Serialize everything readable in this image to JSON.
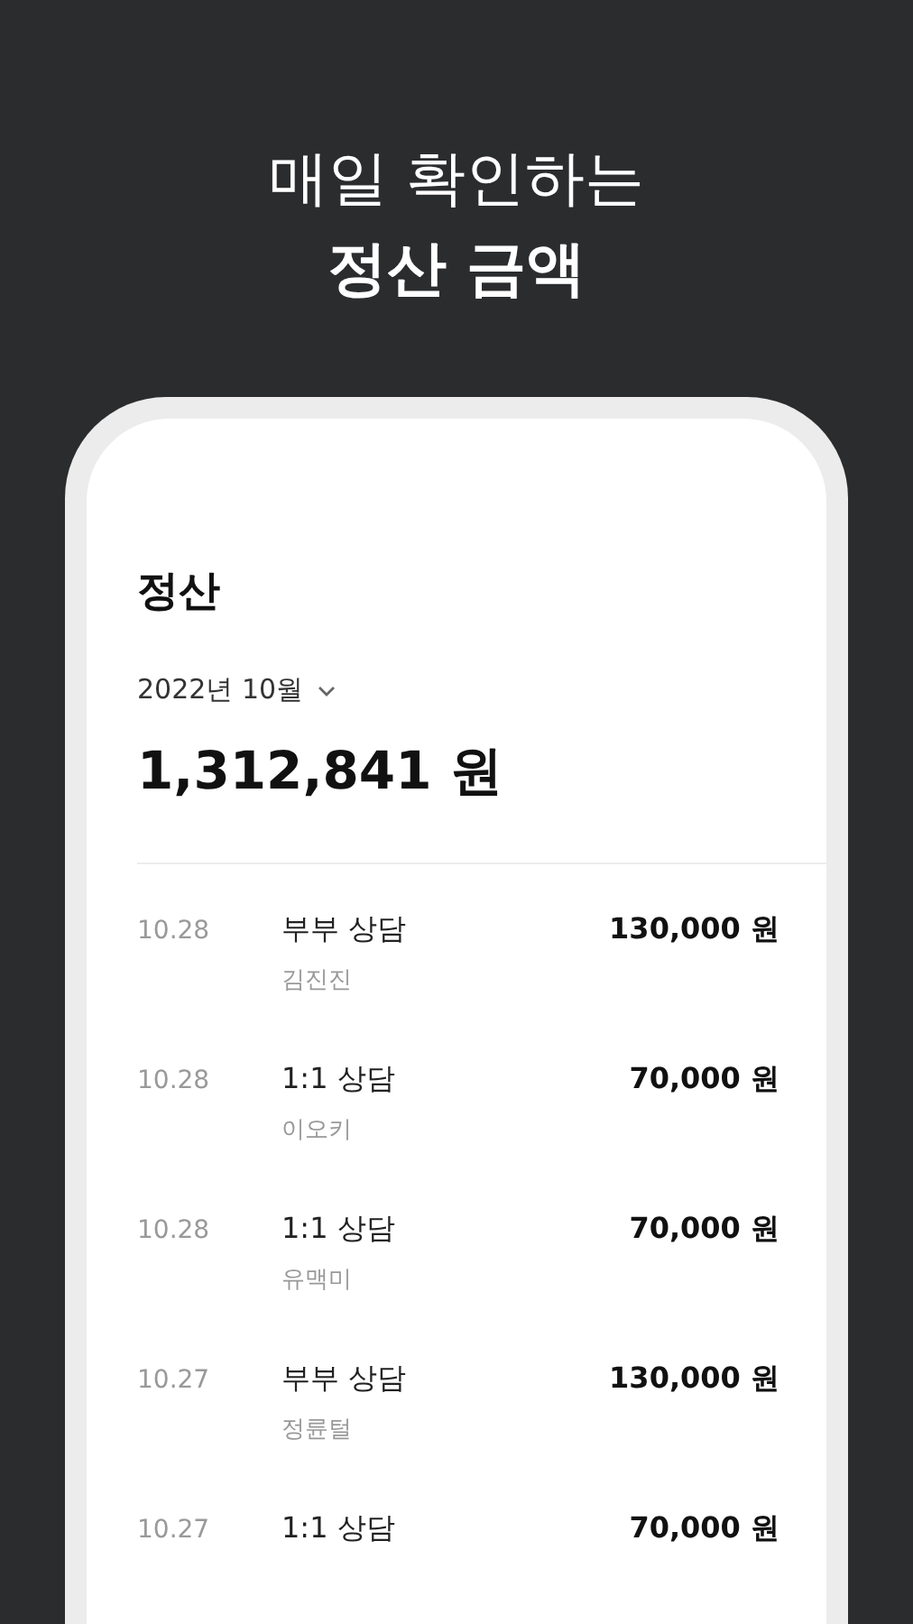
{
  "headline": {
    "line_1": "매일 확인하는",
    "line_2": "정산 금액"
  },
  "screen": {
    "title": "정산",
    "period": "2022년 10월",
    "total": "1,312,841 원",
    "rows": [
      {
        "date": "10.28",
        "service": "부부 상담",
        "client": "김진진",
        "amount": "130,000 원"
      },
      {
        "date": "10.28",
        "service": "1:1 상담",
        "client": "이오키",
        "amount": "70,000 원"
      },
      {
        "date": "10.28",
        "service": "1:1 상담",
        "client": "유맥미",
        "amount": "70,000 원"
      },
      {
        "date": "10.27",
        "service": "부부 상담",
        "client": "정륜털",
        "amount": "130,000 원"
      },
      {
        "date": "10.27",
        "service": "1:1 상담",
        "amount": "70,000 원"
      }
    ]
  }
}
